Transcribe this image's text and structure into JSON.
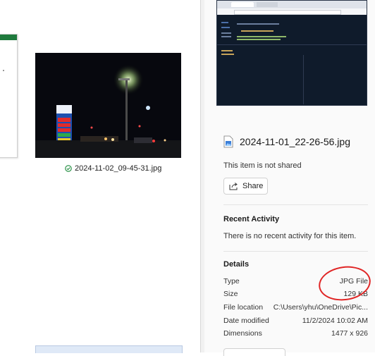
{
  "gallery": {
    "thumbnail_caption": "2024-11-02_09-45-31.jpg",
    "status_icon": "check-circle-icon"
  },
  "details": {
    "file_name": "2024-11-01_22-26-56.jpg",
    "share_status": "This item is not shared",
    "share_label": "Share",
    "recent_activity_title": "Recent Activity",
    "recent_activity_text": "There is no recent activity for this item.",
    "details_title": "Details",
    "rows": [
      {
        "label": "Type",
        "value": "JPG File"
      },
      {
        "label": "Size",
        "value": "129 KB"
      },
      {
        "label": "File location",
        "value": "C:\\Users\\yhu\\OneDrive\\Pic..."
      },
      {
        "label": "Date modified",
        "value": "11/2/2024 10:02 AM"
      },
      {
        "label": "Dimensions",
        "value": "1477 x 926"
      }
    ]
  },
  "colors": {
    "annotation": "#e02525",
    "success": "#1a8a3a"
  }
}
